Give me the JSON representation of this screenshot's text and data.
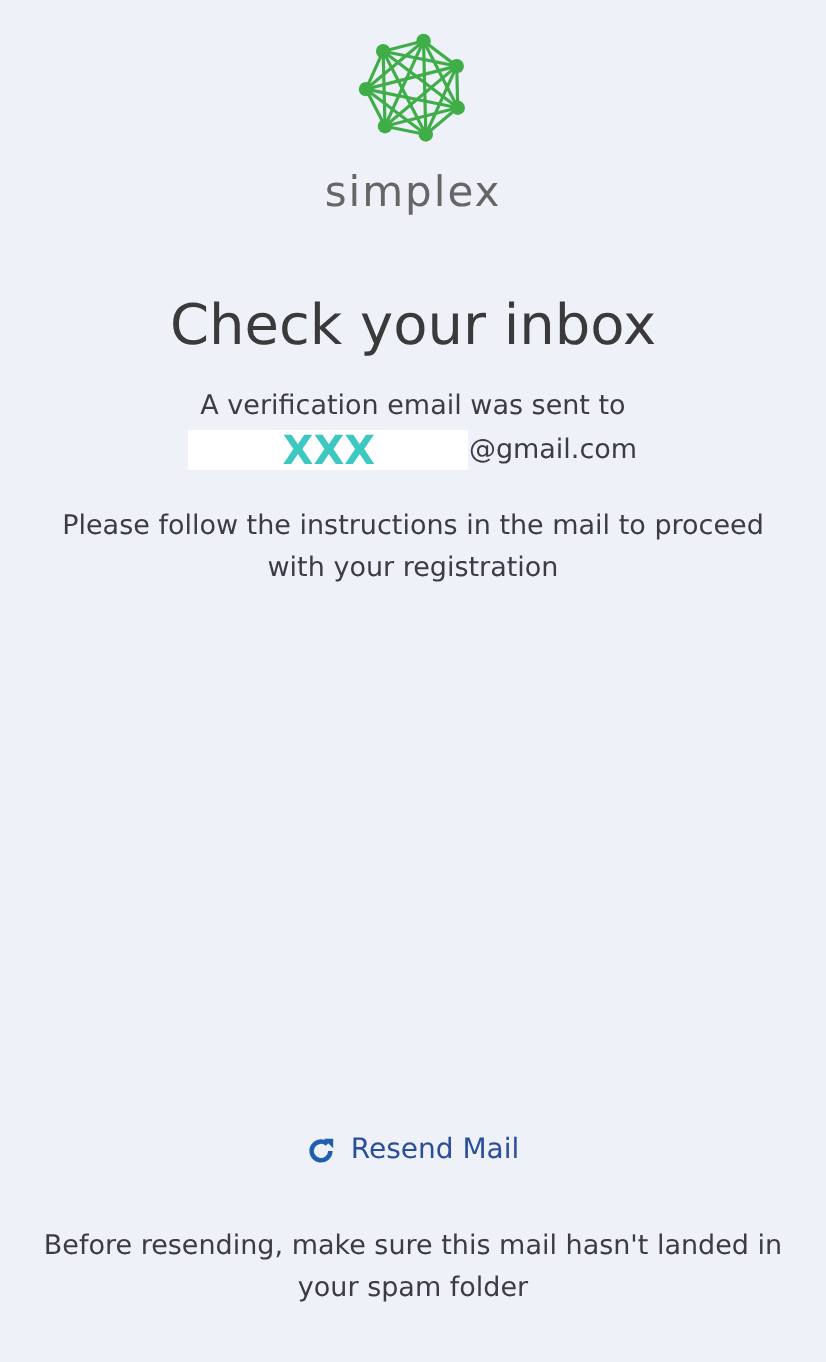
{
  "brand": {
    "name": "simplex"
  },
  "title": "Check your inbox",
  "sent_line": "A verification email was sent to",
  "email": {
    "redacted": "XXX",
    "domain": "@gmail.com"
  },
  "instructions": "Please follow the instructions in the mail to proceed with your registration",
  "resend_button": "Resend Mail",
  "footer_note": "Before resending, make sure this mail hasn't landed in your spam folder"
}
